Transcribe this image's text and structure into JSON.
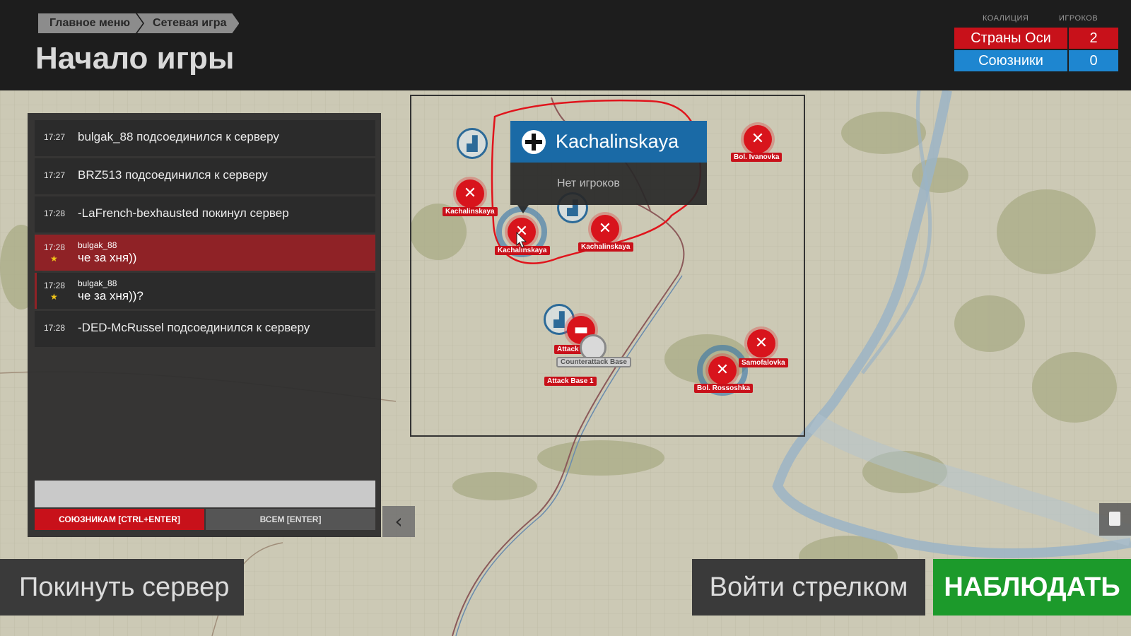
{
  "breadcrumb": [
    "Главное меню",
    "Сетевая игра"
  ],
  "page_title": "Начало игры",
  "coalitions": {
    "col_coalition": "КОАЛИЦИЯ",
    "col_players": "ИГРОКОВ",
    "axis": {
      "name": "Страны Оси",
      "count": "2",
      "color": "#c8111a"
    },
    "allies": {
      "name": "Союзники",
      "count": "0",
      "color": "#1e86d0"
    }
  },
  "chat": {
    "messages": [
      {
        "time": "17:27",
        "text": "bulgak_88 подсоединился к серверу"
      },
      {
        "time": "17:27",
        "text": "BRZ513 подсоединился к серверу"
      },
      {
        "time": "17:28",
        "text": "-LaFrench-bexhausted покинул сервер"
      },
      {
        "time": "17:28",
        "author": "bulgak_88",
        "text": "че за хня))"
      },
      {
        "time": "17:28",
        "author": "bulgak_88",
        "text": "че за хня))?"
      },
      {
        "time": "17:28",
        "text": "-DED-McRussel подсоединился к серверу"
      }
    ],
    "input_value": "",
    "send_allies": "СОЮЗНИКАМ [CTRL+ENTER]",
    "send_all": "ВСЕМ [ENTER]"
  },
  "map": {
    "tooltip": {
      "title": "Kachalinskaya",
      "subtitle": "Нет игроков"
    },
    "labels": {
      "bol_ivanovka": "Bol. Ivanovka",
      "kach1": "Kachalinskaya",
      "kach2": "Kachalinskaya",
      "kach3": "Kachalinskaya",
      "attack": "Attack",
      "counterattack": "Counterattack Base",
      "attack_base_1": "Attack Base 1",
      "samofalovka": "Samofalovka",
      "bol_rossoshka": "Bol. Rossoshka"
    }
  },
  "buttons": {
    "leave": "Покинуть сервер",
    "gunner": "Войти стрелком",
    "watch": "НАБЛЮДАТЬ"
  }
}
